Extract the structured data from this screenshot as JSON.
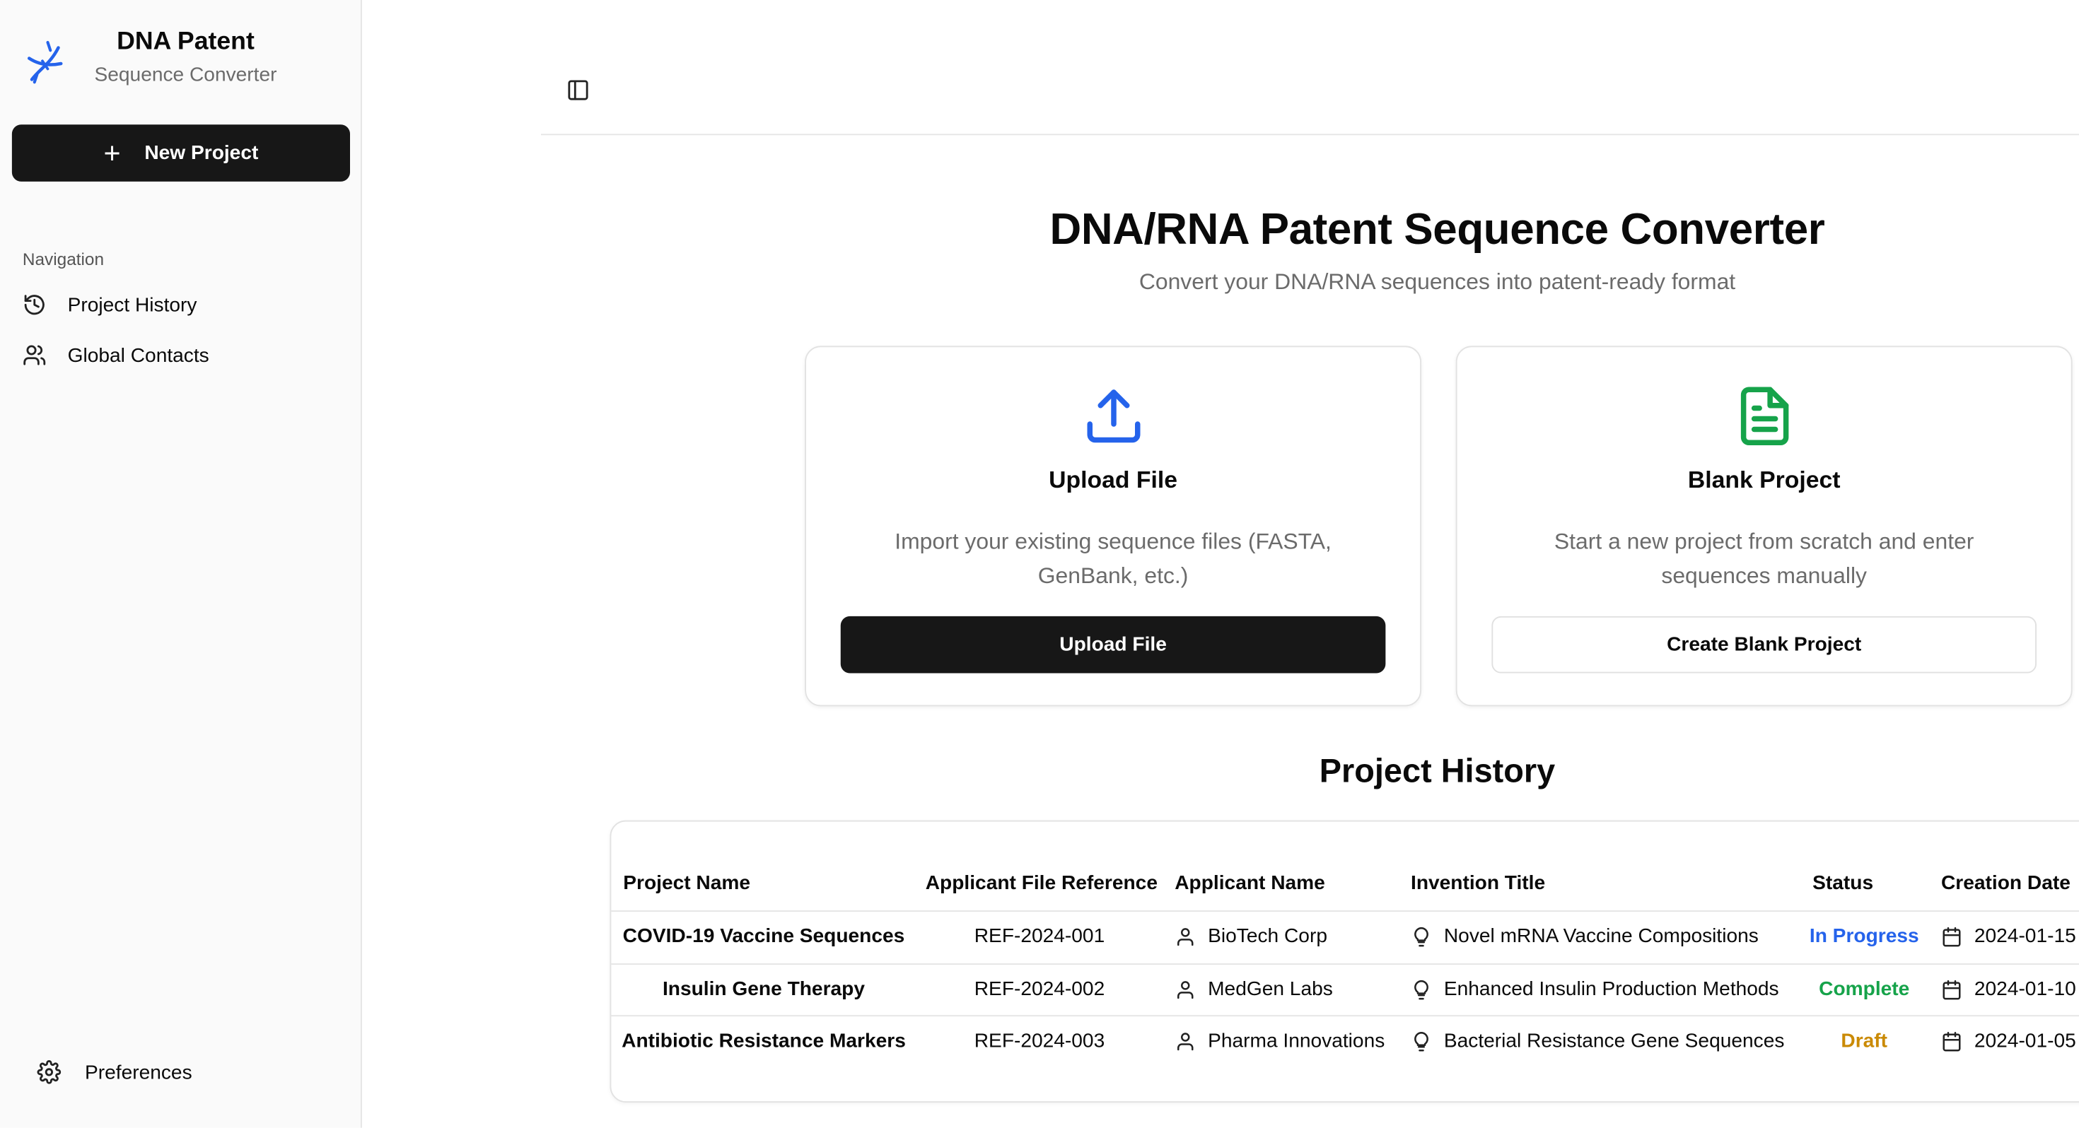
{
  "brand": {
    "title": "DNA Patent",
    "subtitle": "Sequence Converter"
  },
  "sidebar": {
    "new_project_label": "New Project",
    "nav_label": "Navigation",
    "items": [
      {
        "label": "Project History",
        "icon": "history-icon"
      },
      {
        "label": "Global Contacts",
        "icon": "users-icon"
      }
    ],
    "preferences_label": "Preferences"
  },
  "main": {
    "title": "DNA/RNA Patent Sequence Converter",
    "subtitle": "Convert your DNA/RNA sequences into patent-ready format",
    "cards": [
      {
        "title": "Upload File",
        "description": "Import your existing sequence files (FASTA, GenBank, etc.)",
        "button": "Upload File",
        "icon": "upload-icon",
        "icon_color": "#2563eb"
      },
      {
        "title": "Blank Project",
        "description": "Start a new project from scratch and enter sequences manually",
        "button": "Create Blank Project",
        "icon": "file-text-icon",
        "icon_color": "#16a34a"
      }
    ],
    "history_title": "Project History"
  },
  "table": {
    "columns": [
      "Project Name",
      "Applicant File Reference",
      "Applicant Name",
      "Invention Title",
      "Status",
      "Creation Date"
    ],
    "rows": [
      {
        "name": "COVID-19 Vaccine Sequences",
        "ref": "REF-2024-001",
        "applicant": "BioTech Corp",
        "title": "Novel mRNA Vaccine Compositions",
        "status": "In Progress",
        "date": "2024-01-15"
      },
      {
        "name": "Insulin Gene Therapy",
        "ref": "REF-2024-002",
        "applicant": "MedGen Labs",
        "title": "Enhanced Insulin Production Methods",
        "status": "Complete",
        "date": "2024-01-10"
      },
      {
        "name": "Antibiotic Resistance Markers",
        "ref": "REF-2024-003",
        "applicant": "Pharma Innovations",
        "title": "Bacterial Resistance Gene Sequences",
        "status": "Draft",
        "date": "2024-01-05"
      }
    ],
    "status_colors": {
      "In Progress": "#2563eb",
      "Complete": "#16a34a",
      "Draft": "#ca8a04"
    }
  }
}
